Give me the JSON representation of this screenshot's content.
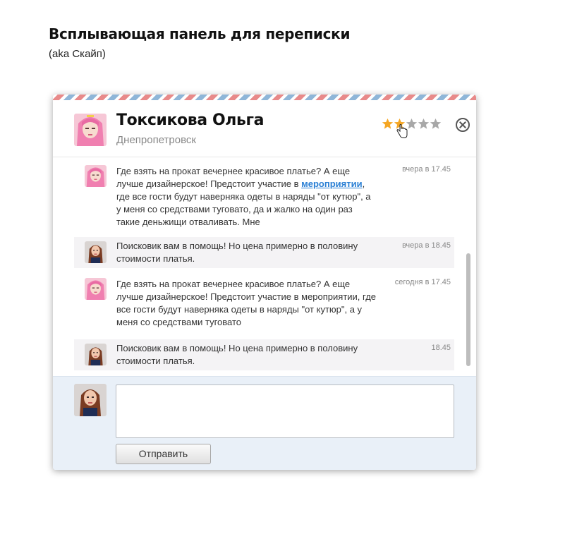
{
  "page": {
    "title": "Всплывающая панель для переписки",
    "subtitle": "(aka Скайп)"
  },
  "contact": {
    "name": "Токсикова Ольга",
    "city": "Днепропетровск",
    "rating": 2,
    "rating_max": 5
  },
  "messages": [
    {
      "author": "contact",
      "text_before": "Где взять на прокат вечернее красивое платье? А еще лучше дизайнерское! Предстоит участие в ",
      "link": "мероприятии",
      "text_after": ", где все гости будут наверняка одеты в наряды \"от кутюр\", а у меня со средствами туговато, да и жалко на один раз такие деньжищи отваливать. Мне",
      "time": "вчера в 17.45"
    },
    {
      "author": "me",
      "text": "Поисковик вам в помощь! Но цена примерно в половину стоимости платья.",
      "time": "вчера в 18.45"
    },
    {
      "author": "contact",
      "text": "Где взять на прокат вечернее красивое платье? А еще лучше дизайнерское! Предстоит участие в мероприятии, где все гости будут наверняка одеты в наряды \"от кутюр\", а у меня со средствами туговато",
      "time": "сегодня в 17.45"
    },
    {
      "author": "me",
      "text": "Поисковик вам в помощь! Но цена примерно в половину стоимости платья.",
      "time": "18.45"
    }
  ],
  "composer": {
    "value": "",
    "send_label": "Отправить"
  },
  "colors": {
    "star_active": "#f5a623",
    "star_inactive": "#a8a8a8",
    "link": "#2a7fd4",
    "composer_bg": "#e9f0f8"
  }
}
